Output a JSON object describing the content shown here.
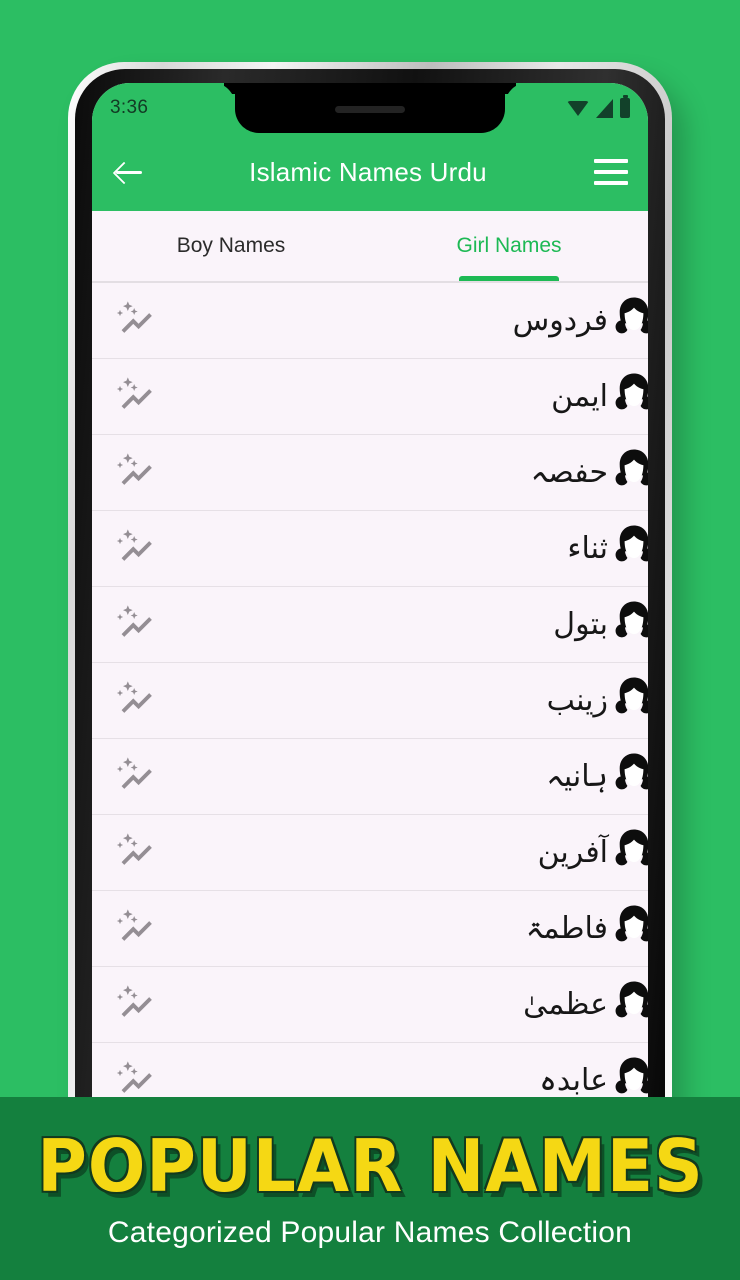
{
  "background": {
    "page_green": "#2cbe63",
    "banner_green": "#14803e",
    "accent": "#1db954"
  },
  "status_bar": {
    "time": "3:36",
    "icons": [
      "wifi-icon",
      "cellular-signal-icon",
      "battery-icon"
    ]
  },
  "app_bar": {
    "back_icon": "back-arrow-icon",
    "title": "Islamic Names Urdu",
    "menu_icon": "hamburger-menu-icon"
  },
  "tabs": [
    {
      "label": "Boy Names",
      "active": false
    },
    {
      "label": "Girl Names",
      "active": true
    }
  ],
  "name_list": {
    "row_icon_left": "sparkle-icon",
    "row_icon_right": "girl-avatar-icon",
    "rows": [
      {
        "name": "فردوس"
      },
      {
        "name": "ایمن"
      },
      {
        "name": "حفصہ"
      },
      {
        "name": "ثناء"
      },
      {
        "name": "بتول"
      },
      {
        "name": "زینب"
      },
      {
        "name": "ہانیہ"
      },
      {
        "name": "آفرین"
      },
      {
        "name": "فاطمۃ"
      },
      {
        "name": "عظمیٰ"
      },
      {
        "name": "عابدہ"
      }
    ]
  },
  "banner": {
    "title": "POPULAR NAMES",
    "subtitle": "Categorized Popular Names Collection"
  }
}
